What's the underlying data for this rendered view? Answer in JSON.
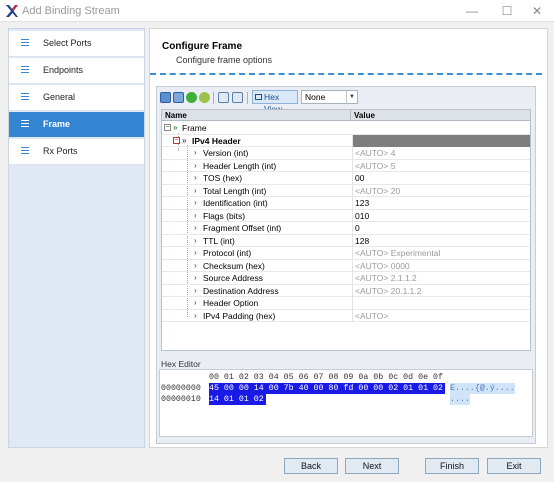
{
  "window": {
    "title": "Add Binding Stream",
    "minimize": "—",
    "maximize": "☐",
    "close": "✕"
  },
  "sidebar": {
    "items": [
      {
        "label": "Select Ports",
        "active": false
      },
      {
        "label": "Endpoints",
        "active": false
      },
      {
        "label": "General",
        "active": false
      },
      {
        "label": "Frame",
        "active": true
      },
      {
        "label": "Rx Ports",
        "active": false
      }
    ]
  },
  "header": {
    "title": "Configure Frame",
    "subtitle": "Configure frame options"
  },
  "toolbar": {
    "hex_view_label": "Hex View",
    "select_value": "None"
  },
  "grid": {
    "col_name": "Name",
    "col_value": "Value",
    "frame_label": "Frame",
    "ipv4_label": "IPv4 Header",
    "fields": [
      {
        "name": "Version (int)",
        "value": "<AUTO> 4",
        "auto": true
      },
      {
        "name": "Header Length (int)",
        "value": "<AUTO> 5",
        "auto": true
      },
      {
        "name": "TOS (hex)",
        "value": "00",
        "auto": false
      },
      {
        "name": "Total Length (int)",
        "value": "<AUTO> 20",
        "auto": true
      },
      {
        "name": "Identification  (int)",
        "value": "123",
        "auto": false
      },
      {
        "name": "Flags (bits)",
        "value": "010",
        "auto": false
      },
      {
        "name": "Fragment Offset (int)",
        "value": "0",
        "auto": false
      },
      {
        "name": "TTL (int)",
        "value": "128",
        "auto": false
      },
      {
        "name": "Protocol (int)",
        "value": "<AUTO> Experimental",
        "auto": true
      },
      {
        "name": "Checksum (hex)",
        "value": "<AUTO> 0000",
        "auto": true
      },
      {
        "name": "Source Address",
        "value": "<AUTO> 2.1.1.2",
        "auto": true
      },
      {
        "name": "Destination Address",
        "value": "<AUTO> 20.1.1.2",
        "auto": true
      },
      {
        "name": "Header Option",
        "value": "",
        "auto": false
      },
      {
        "name": "IPv4 Padding (hex)",
        "value": "<AUTO>",
        "auto": true
      }
    ]
  },
  "hex_editor": {
    "title": "Hex Editor",
    "columns": "00 01 02 03 04 05 06 07 08 09 0a 0b 0c 0d 0e 0f",
    "rows": [
      {
        "offset": "00000000",
        "bytes": "45 00 00 14 00 7b 40 00 80 fd 00 00 02 01 01 02",
        "ascii": "E....{@.ý...."
      },
      {
        "offset": "00000010",
        "bytes": "14 01 01 02",
        "ascii": "...."
      }
    ]
  },
  "footer": {
    "back": "Back",
    "next": "Next",
    "finish": "Finish",
    "exit": "Exit"
  }
}
